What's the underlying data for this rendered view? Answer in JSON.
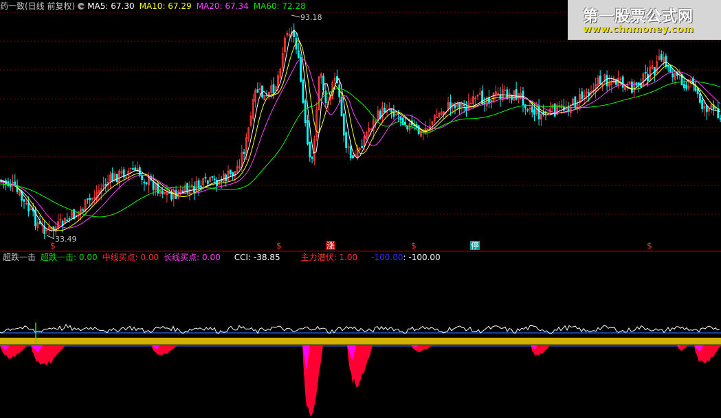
{
  "header": {
    "title": "药一致(日线 前复权)",
    "ma5_label": "MA5: 67.30",
    "ma10_label": "MA10: 67.29",
    "ma20_label": "MA20: 67.34",
    "ma60_label": "MA60: 72.28"
  },
  "indicator": {
    "name": "超跌一击",
    "v1": "超跌一击: 0.00",
    "v2": "中线买点: 0.00",
    "v3": "长线买点: 0.00",
    "v4": "CCI: -38.85",
    "v5": "主力潜伏: 1.00",
    "v6": "-100.00",
    "v7": ": -100.00"
  },
  "watermark": {
    "line1": "第一股票公式网",
    "line2": "www.chnmoney.com"
  },
  "chart_data": [
    {
      "type": "candlestick",
      "annotations": {
        "high": "93.18",
        "low": "33.49"
      },
      "markers": [
        {
          "text": "$",
          "color": "#ff3030"
        },
        {
          "text": "$",
          "color": "#ff3030"
        },
        {
          "text": "涨",
          "color": "#ffffff",
          "bg": "#c00000"
        },
        {
          "text": "$",
          "color": "#ff3030"
        },
        {
          "text": "停",
          "color": "#ffffff",
          "bg": "#00a0a0"
        },
        {
          "text": "$",
          "color": "#ff3030"
        }
      ],
      "colors": {
        "up": "#ff3c3c",
        "down": "#00ffff",
        "ma5": "#ffffff",
        "ma10": "#ffff00",
        "ma20": "#ff40ff",
        "ma60": "#00ff00"
      }
    },
    {
      "type": "area",
      "series": [
        {
          "color": "#ffffff"
        },
        {
          "color": "#ff0033"
        },
        {
          "color": "#ff00ff"
        }
      ]
    }
  ]
}
